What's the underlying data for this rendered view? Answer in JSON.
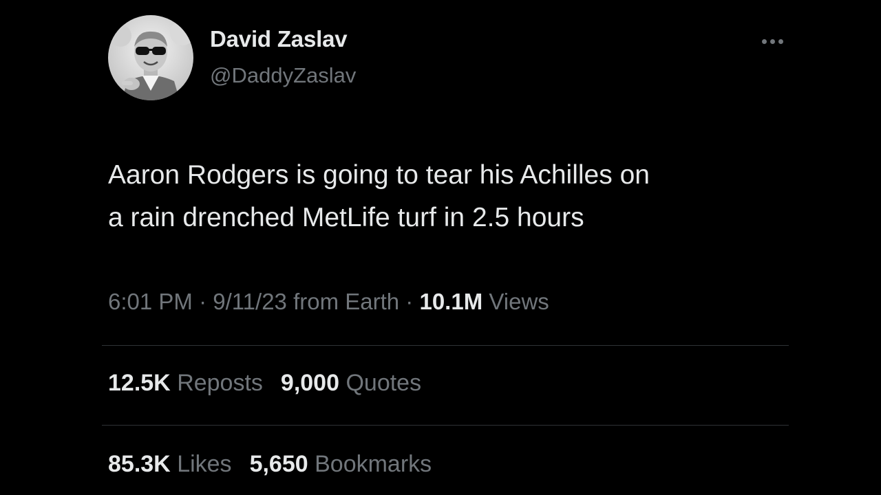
{
  "author": {
    "display_name": "David Zaslav",
    "handle": "@DaddyZaslav"
  },
  "tweet": {
    "text_lines": [
      "Aaron Rodgers is going to tear his Achilles on",
      "a rain drenched MetLife turf in 2.5 hours"
    ],
    "time": "6:01 PM",
    "separator": "·",
    "date": "9/11/23",
    "source": "from Earth",
    "views_count": "10.1M",
    "views_label": "Views"
  },
  "stats": {
    "reposts_count": "12.5K",
    "reposts_label": "Reposts",
    "quotes_count": "9,000",
    "quotes_label": "Quotes",
    "likes_count": "85.3K",
    "likes_label": "Likes",
    "bookmarks_count": "5,650",
    "bookmarks_label": "Bookmarks"
  },
  "icons": {
    "more": "more-horizontal-icon"
  },
  "colors": {
    "background": "#000000",
    "primary_text": "#e7e9ea",
    "secondary_text": "#71767b",
    "divider": "#2f3336"
  }
}
